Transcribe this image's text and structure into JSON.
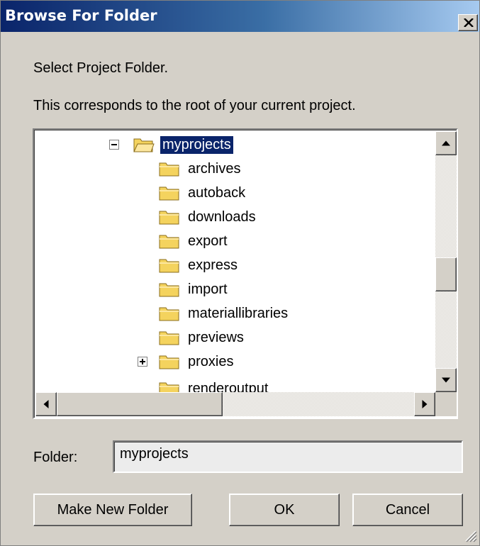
{
  "window": {
    "title": "Browse For Folder"
  },
  "prompt": "Select Project Folder.",
  "description": "This corresponds to the root of your current project.",
  "tree": {
    "items": [
      {
        "label": "myprojects",
        "selected": true,
        "expander": "minus",
        "icon": "open-folder-icon"
      },
      {
        "label": "archives",
        "icon": "folder-icon"
      },
      {
        "label": "autoback",
        "icon": "folder-icon"
      },
      {
        "label": "downloads",
        "icon": "folder-icon"
      },
      {
        "label": "export",
        "icon": "folder-icon"
      },
      {
        "label": "express",
        "icon": "folder-icon"
      },
      {
        "label": "import",
        "icon": "folder-icon"
      },
      {
        "label": "materiallibraries",
        "icon": "folder-icon"
      },
      {
        "label": "previews",
        "icon": "folder-icon"
      },
      {
        "label": "proxies",
        "expander": "plus",
        "icon": "folder-icon"
      },
      {
        "label": "renderoutput",
        "icon": "folder-icon",
        "partially_visible": true
      }
    ]
  },
  "folder": {
    "label": "Folder:",
    "value": "myprojects"
  },
  "buttons": {
    "make_new_folder": "Make New Folder",
    "ok": "OK",
    "cancel": "Cancel"
  },
  "colors": {
    "selection": "#0a246a",
    "folder_yellow": "#f4d35e",
    "dialog_bg": "#d4d0c8"
  }
}
